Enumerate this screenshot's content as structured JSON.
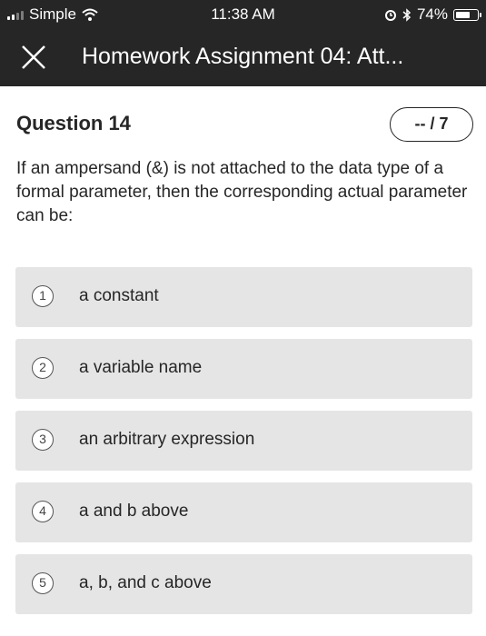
{
  "status_bar": {
    "carrier": "Simple",
    "time": "11:38 AM",
    "battery": "74%",
    "battery_level": 0.74
  },
  "header": {
    "title": "Homework Assignment 04: Att..."
  },
  "question": {
    "title": "Question 14",
    "score": "-- / 7",
    "text": "If an ampersand (&) is not attached to the data type of a formal parameter, then the corresponding actual parameter can be:"
  },
  "options": [
    {
      "num": "1",
      "label": "a constant"
    },
    {
      "num": "2",
      "label": "a variable name"
    },
    {
      "num": "3",
      "label": "an arbitrary expression"
    },
    {
      "num": "4",
      "label": "a and b above"
    },
    {
      "num": "5",
      "label": "a, b, and c above"
    }
  ],
  "colors": {
    "header_bg": "#262626",
    "option_bg": "#e5e5e5",
    "text": "#262626"
  }
}
